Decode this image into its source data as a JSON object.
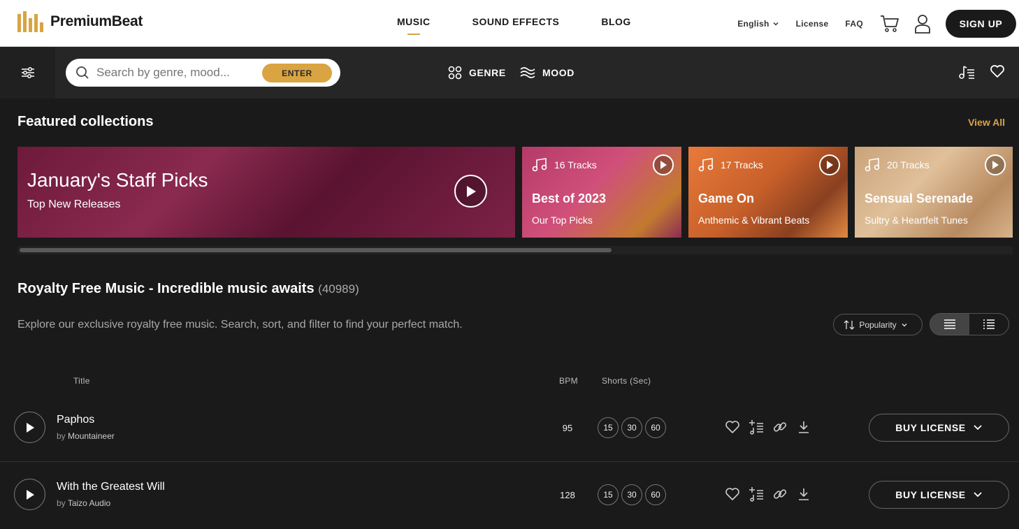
{
  "header": {
    "brand": "PremiumBeat",
    "nav": [
      {
        "label": "MUSIC",
        "active": true
      },
      {
        "label": "SOUND EFFECTS",
        "active": false
      },
      {
        "label": "BLOG",
        "active": false
      }
    ],
    "language": "English",
    "license": "License",
    "faq": "FAQ",
    "signup": "SIGN UP"
  },
  "searchbar": {
    "placeholder": "Search by genre, mood...",
    "enter": "ENTER",
    "genre": "GENRE",
    "mood": "MOOD"
  },
  "featured": {
    "title": "Featured collections",
    "view_all": "View All",
    "main": {
      "title": "January's Staff Picks",
      "subtitle": "Top New Releases"
    },
    "cards": [
      {
        "tracks": "16 Tracks",
        "title": "Best of 2023",
        "subtitle": "Our Top Picks"
      },
      {
        "tracks": "17 Tracks",
        "title": "Game On",
        "subtitle": "Anthemic & Vibrant Beats"
      },
      {
        "tracks": "20 Tracks",
        "title": "Sensual Serenade",
        "subtitle": "Sultry & Heartfelt Tunes"
      }
    ]
  },
  "music": {
    "title": "Royalty Free Music - Incredible music awaits",
    "count": "(40989)",
    "description": "Explore our exclusive royalty free music. Search, sort, and filter to find your perfect match.",
    "sort": "Popularity",
    "columns": {
      "title": "Title",
      "bpm": "BPM",
      "shorts": "Shorts (Sec)"
    },
    "tracks": [
      {
        "title": "Paphos",
        "by": "by",
        "artist": "Mountaineer",
        "bpm": "95",
        "shorts": [
          "15",
          "30",
          "60"
        ],
        "buy": "BUY LICENSE"
      },
      {
        "title": "With the Greatest Will",
        "by": "by",
        "artist": "Taizo Audio",
        "bpm": "128",
        "shorts": [
          "15",
          "30",
          "60"
        ],
        "buy": "BUY LICENSE"
      }
    ]
  },
  "colors": {
    "accent": "#d9a441",
    "background": "#1a1a1a",
    "header_bg": "#ffffff",
    "searchbar_bg": "#262626"
  }
}
